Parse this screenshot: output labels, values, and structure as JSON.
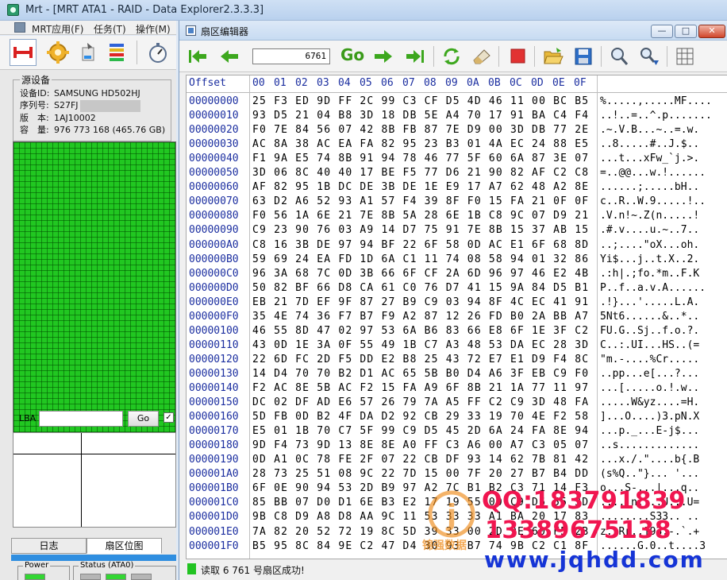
{
  "main_window": {
    "title": "Mrt - [MRT ATA1 - RAID - Data Explorer2.3.3.3]"
  },
  "main_menu": {
    "items": [
      "MRT应用(F)",
      "任务(T)",
      "操作(M)"
    ]
  },
  "left_toolbar": {
    "icons": [
      "connect-icon",
      "gear-icon",
      "disk-tool-icon",
      "sector-map-icon",
      "stopwatch-icon"
    ]
  },
  "device": {
    "legend": "源设备",
    "rows": [
      {
        "key": "设备ID:",
        "value": "SAMSUNG HD502HJ"
      },
      {
        "key": "序列号:",
        "value": "S27FJ"
      },
      {
        "key": "版　本:",
        "value": "1AJ10002"
      },
      {
        "key": "容　量:",
        "value": "976 773 168 (465.76 GB)"
      }
    ]
  },
  "lba": {
    "label": "LBA",
    "value": "",
    "go_label": "Go",
    "checkbox_mark": "✓"
  },
  "left_tabs": [
    {
      "label": "日志",
      "selected": false
    },
    {
      "label": "扇区位图",
      "selected": true
    }
  ],
  "status_groups": [
    {
      "legend": "Power"
    },
    {
      "legend": "Status (ATA0)"
    }
  ],
  "sector_editor": {
    "title": "扇区编辑器",
    "window_buttons": {
      "minimize": "—",
      "maximize": "□",
      "close": "✕"
    },
    "sector_value": "6761",
    "go_label": "Go",
    "status_text": "读取 6 761 号扇区成功!",
    "toolbar_icons": [
      "first-sector-icon",
      "previous-sector-icon",
      "next-sector-icon",
      "last-sector-icon",
      "refresh-icon",
      "erase-icon",
      "stop-icon",
      "open-folder-icon",
      "save-icon",
      "search-icon",
      "search-next-icon",
      "grid-view-icon"
    ]
  },
  "hex_view": {
    "offset_header": "Offset",
    "columns": [
      "00",
      "01",
      "02",
      "03",
      "04",
      "05",
      "06",
      "07",
      "08",
      "09",
      "0A",
      "0B",
      "0C",
      "0D",
      "0E",
      "0F"
    ],
    "rows": [
      {
        "offset": "00000000",
        "hex": "25 F3 ED 9D FF 2C 99 C3 CF D5 4D 46 11 00 BC B5",
        "ascii": "%.....,.....MF...."
      },
      {
        "offset": "00000010",
        "hex": "93 D5 21 04 B8 3D 18 DB 5E A4 70 17 91 BA C4 F4",
        "ascii": "..!..=..^.p......."
      },
      {
        "offset": "00000020",
        "hex": "F0 7E 84 56 07 42 8B FB 87 7E D9 00 3D DB 77 2E",
        "ascii": ".~.V.B...~..=.w."
      },
      {
        "offset": "00000030",
        "hex": "AC 8A 38 AC EA FA 82 95 23 B3 01 4A EC 24 88 E5",
        "ascii": "..8.....#..J.$.."
      },
      {
        "offset": "00000040",
        "hex": "F1 9A E5 74 8B 91 94 78 46 77 5F 60 6A 87 3E 07",
        "ascii": "...t...xFw_`j.>."
      },
      {
        "offset": "00000050",
        "hex": "3D 06 8C 40 40 17 BE F5 77 D6 21 90 82 AF C2 C8",
        "ascii": "=..@@...w.!......"
      },
      {
        "offset": "00000060",
        "hex": "AF 82 95 1B DC DE 3B DE 1E E9 17 A7 62 48 A2 8E",
        "ascii": "......;.....bH.."
      },
      {
        "offset": "00000070",
        "hex": "63 D2 A6 52 93 A1 57 F4 39 8F F0 15 FA 21 0F 0F",
        "ascii": "c..R..W.9.....!.."
      },
      {
        "offset": "00000080",
        "hex": "F0 56 1A 6E 21 7E 8B 5A 28 6E 1B C8 9C 07 D9 21",
        "ascii": ".V.n!~.Z(n.....!"
      },
      {
        "offset": "00000090",
        "hex": "C9 23 90 76 03 A9 14 D7 75 91 7E 8B 15 37 AB 15",
        "ascii": ".#.v....u.~..7.."
      },
      {
        "offset": "000000A0",
        "hex": "C8 16 3B DE 97 94 BF 22 6F 58 0D AC E1 6F 68 8D",
        "ascii": "..;....\"oX...oh."
      },
      {
        "offset": "000000B0",
        "hex": "59 69 24 EA FD 1D 6A C1 11 74 08 58 94 01 32 86",
        "ascii": "Yi$...j..t.X..2."
      },
      {
        "offset": "000000C0",
        "hex": "96 3A 68 7C 0D 3B 66 6F CF 2A 6D 96 97 46 E2 4B",
        "ascii": ".:h|.;fo.*m..F.K"
      },
      {
        "offset": "000000D0",
        "hex": "50 82 BF 66 D8 CA 61 C0 76 D7 41 15 9A 84 D5 B1",
        "ascii": "P..f..a.v.A......"
      },
      {
        "offset": "000000E0",
        "hex": "EB 21 7D EF 9F 87 27 B9 C9 03 94 8F 4C EC 41 91",
        "ascii": ".!}...'.....L.A."
      },
      {
        "offset": "000000F0",
        "hex": "35 4E 74 36 F7 B7 F9 A2 87 12 26 FD B0 2A BB A7",
        "ascii": "5Nt6......&..*.."
      },
      {
        "offset": "00000100",
        "hex": "46 55 8D 47 02 97 53 6A B6 83 66 E8 6F 1E 3F C2",
        "ascii": "FU.G..Sj..f.o.?."
      },
      {
        "offset": "00000110",
        "hex": "43 0D 1E 3A 0F 55 49 1B C7 A3 48 53 DA EC 28 3D",
        "ascii": "C..:.UI...HS..(="
      },
      {
        "offset": "00000120",
        "hex": "22 6D FC 2D F5 DD E2 B8 25 43 72 E7 E1 D9 F4 8C",
        "ascii": "\"m.-....%Cr....."
      },
      {
        "offset": "00000130",
        "hex": "14 D4 70 70 B2 D1 AC 65 5B B0 D4 A6 3F EB C9 F0",
        "ascii": "..pp...e[...?..."
      },
      {
        "offset": "00000140",
        "hex": "F2 AC 8E 5B AC F2 15 FA A9 6F 8B 21 1A 77 11 97",
        "ascii": "...[.....o.!.w.."
      },
      {
        "offset": "00000150",
        "hex": "DC 02 DF AD E6 57 26 79 7A A5 FF C2 C9 3D 48 FA",
        "ascii": ".....W&yz....=H."
      },
      {
        "offset": "00000160",
        "hex": "5D FB 0D B2 4F DA D2 92 CB 29 33 19 70 4E F2 58",
        "ascii": "]...O....)3.pN.X"
      },
      {
        "offset": "00000170",
        "hex": "E5 01 1B 70 C7 5F 99 C9 D5 45 2D 6A 24 FA 8E 94",
        "ascii": "...p._...E-j$..."
      },
      {
        "offset": "00000180",
        "hex": "9D F4 73 9D 13 8E 8E A0 FF C3 A6 00 A7 C3 05 07",
        "ascii": "..s............."
      },
      {
        "offset": "00000190",
        "hex": "0D A1 0C 78 FE 2F 07 22 CB DF 93 14 62 7B 81 42",
        "ascii": "...x./.\"....b{.B"
      },
      {
        "offset": "000001A0",
        "hex": "28 73 25 51 08 9C 22 7D 15 00 7F 20 27 B7 B4 DD",
        "ascii": "(s%Q..\"}... '..."
      },
      {
        "offset": "000001B0",
        "hex": "6F 0E 90 94 53 2D B9 97 A2 7C B1 B2 C3 71 14 F3",
        "ascii": "o...S-...|...q.."
      },
      {
        "offset": "000001C0",
        "hex": "85 BB 07 D0 D1 6E B3 E2 17 19 55 00 C9 D6 55 3D",
        "ascii": ".....n....U...U="
      },
      {
        "offset": "000001D0",
        "hex": "9B C8 D9 A8 D8 AA 9C 11 53 33 33 A1 BA 20 17 83",
        "ascii": "........S33.. .."
      },
      {
        "offset": "000001E0",
        "hex": "7A 82 20 52 72 19 8C 5D 39 33 00 2D 9E 60 F5 2B",
        "ascii": "z. Rr..]93.-.`.+"
      },
      {
        "offset": "000001F0",
        "hex": "B5 95 8C 84 9E C2 47 D4 30 93 B7 74 9B C2 C1 8F",
        "ascii": "......G.0..t....3"
      }
    ]
  },
  "watermark": {
    "qq": "QQ:183791839",
    "phone": "13389675138",
    "url": "www.jqhdd.com",
    "brand": "锦强数据",
    "logo_letter": "j"
  }
}
